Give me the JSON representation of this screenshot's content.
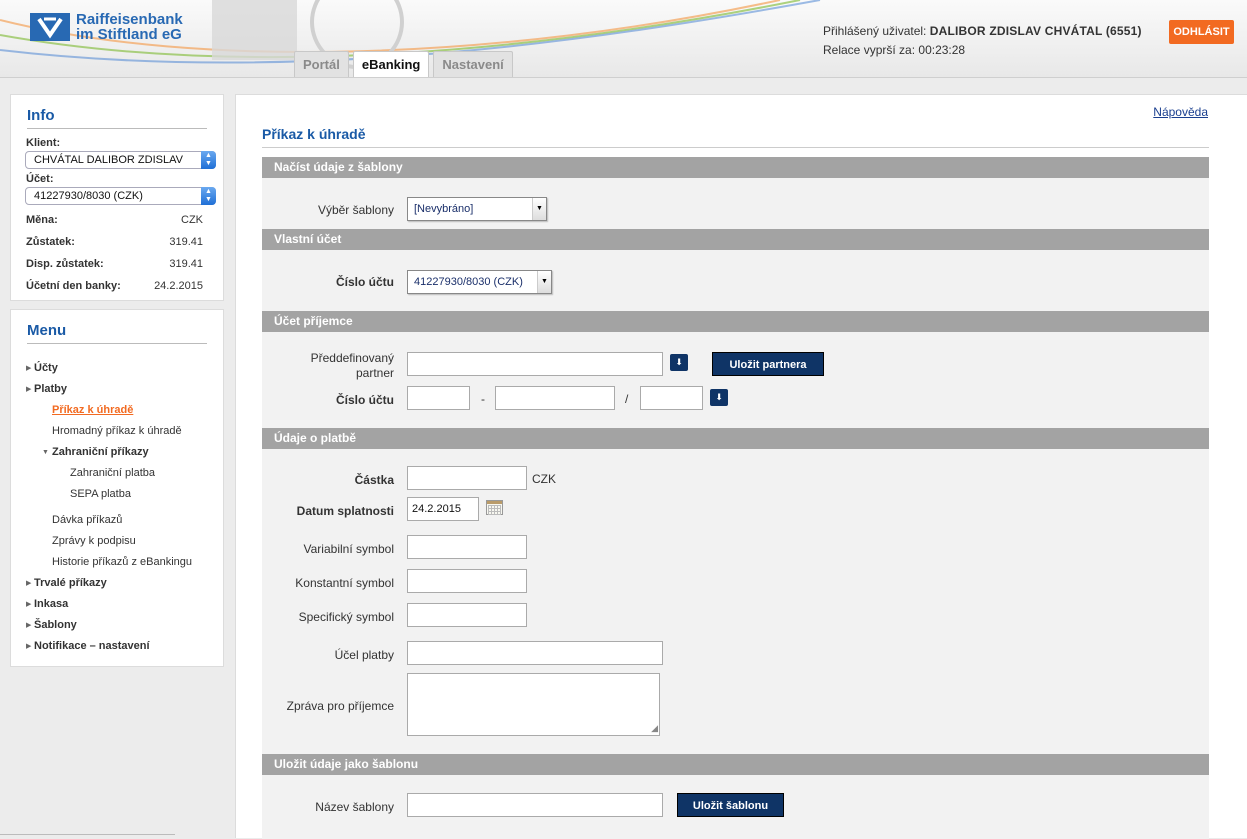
{
  "header": {
    "bank_name_line1": "Raiffeisenbank",
    "bank_name_line2": "im Stiftland eG",
    "logged_user_label": "Přihlášený uživatel:",
    "logged_user_name": "DALIBOR ZDISLAV CHVÁTAL (6551)",
    "session_label": "Relace vyprší za:",
    "session_time": "00:23:28",
    "logout_label": "ODHLÁSIT",
    "tabs": [
      {
        "label": "Portál",
        "active": false
      },
      {
        "label": "eBanking",
        "active": true
      },
      {
        "label": "Nastavení",
        "active": false
      }
    ],
    "brand_color": "#2869b3",
    "accent_color": "#f26a21"
  },
  "info": {
    "title": "Info",
    "client_label": "Klient:",
    "client_value": "CHVÁTAL DALIBOR ZDISLAV",
    "account_label": "Účet:",
    "account_value": "41227930/8030 (CZK)",
    "rows": [
      {
        "label": "Měna:",
        "value": "CZK"
      },
      {
        "label": "Zůstatek:",
        "value": "319.41"
      },
      {
        "label": "Disp. zůstatek:",
        "value": "319.41"
      },
      {
        "label": "Účetní den banky:",
        "value": "24.2.2015"
      }
    ]
  },
  "menu": {
    "title": "Menu",
    "items": {
      "ucty": "Účty",
      "platby": "Platby",
      "prikaz": "Příkaz k úhradě",
      "hromadny": "Hromadný příkaz k úhradě",
      "zahranicni": "Zahraniční příkazy",
      "zahranicni_platba": "Zahraniční platba",
      "sepa": "SEPA platba",
      "davka": "Dávka příkazů",
      "zpravy": "Zprávy k podpisu",
      "historie": "Historie příkazů z eBankingu",
      "trvale": "Trvalé příkazy",
      "inkasa": "Inkasa",
      "sablony": "Šablony",
      "notifikace": "Notifikace – nastavení"
    }
  },
  "main": {
    "help_link": "Nápověda",
    "page_title": "Příkaz k úhradě",
    "sections": {
      "template_load": "Načíst údaje z šablony",
      "own_account": "Vlastní účet",
      "recipient": "Účet příjemce",
      "payment": "Údaje o platbě",
      "save_template": "Uložit údaje jako šablonu"
    },
    "fields": {
      "template_select_label": "Výběr šablony",
      "template_select_value": "[Nevybráno]",
      "account_number_label": "Číslo účtu",
      "own_account_value": "41227930/8030 (CZK)",
      "partner_label_1": "Předdefinovaný",
      "partner_label_2": "partner",
      "save_partner_button": "Uložit partnera",
      "recipient_account_label": "Číslo účtu",
      "dash": "-",
      "slash": "/",
      "amount_label": "Částka",
      "currency": "CZK",
      "due_date_label": "Datum splatnosti",
      "due_date_value": "24.2.2015",
      "variable_symbol_label": "Variabilní symbol",
      "constant_symbol_label": "Konstantní symbol",
      "specific_symbol_label": "Specifický symbol",
      "purpose_label": "Účel platby",
      "message_label": "Zpráva pro příjemce",
      "template_name_label": "Název šablony",
      "save_template_button": "Uložit šablonu"
    }
  }
}
